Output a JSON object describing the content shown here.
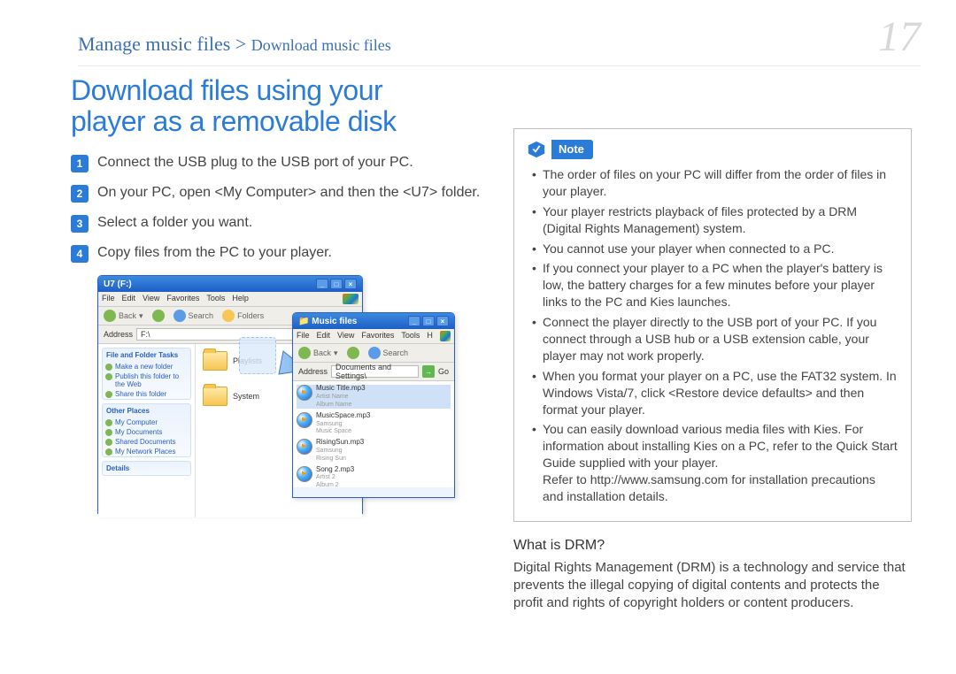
{
  "header": {
    "breadcrumb_main": "Manage music files",
    "breadcrumb_sep": " > ",
    "breadcrumb_sub": "Download music files",
    "page_number": "17"
  },
  "title": {
    "line1": "Download files using your",
    "line2": "player as a removable disk"
  },
  "steps": {
    "s1": "Connect the USB plug to the USB port of your PC.",
    "s2": "On your PC, open <My Computer> and then the <U7> folder.",
    "s3": "Select a folder you want.",
    "s4": "Copy files from the PC to your player."
  },
  "win1": {
    "title": "U7 (F:)",
    "menu": {
      "m1": "File",
      "m2": "Edit",
      "m3": "View",
      "m4": "Favorites",
      "m5": "Tools",
      "m6": "Help"
    },
    "toolbar": {
      "back": "Back",
      "search": "Search",
      "folders": "Folders"
    },
    "addr_label": "Address",
    "addr_value": "F:\\",
    "panel1": {
      "head": "File and Folder Tasks",
      "i1": "Make a new folder",
      "i2": "Publish this folder to the Web",
      "i3": "Share this folder"
    },
    "panel2": {
      "head": "Other Places",
      "i1": "My Computer",
      "i2": "My Documents",
      "i3": "Shared Documents",
      "i4": "My Network Places"
    },
    "panel3": {
      "head": "Details"
    },
    "folders": {
      "f1": "Playlists",
      "f2": "System"
    }
  },
  "win2": {
    "title": "Music files",
    "menu": {
      "m1": "File",
      "m2": "Edit",
      "m3": "View",
      "m4": "Favorites",
      "m5": "Tools",
      "m6": "H"
    },
    "toolbar": {
      "back": "Back",
      "search": "Search"
    },
    "addr_label": "Address",
    "addr_value": "Documents and Settings\\",
    "go": "Go",
    "files": {
      "f1": {
        "name": "Music Title.mp3",
        "l2": "Artist Name",
        "l3": "Album Name"
      },
      "f2": {
        "name": "MusicSpace.mp3",
        "l2": "Samsung",
        "l3": "Music Space"
      },
      "f3": {
        "name": "RisingSun.mp3",
        "l2": "Samsung",
        "l3": "Rising Sun"
      },
      "f4": {
        "name": "Song 2.mp3",
        "l2": "Artist 2",
        "l3": "Album 2"
      }
    }
  },
  "note": {
    "label": "Note",
    "n1": "The order of files on your PC will differ from the order of files in your player.",
    "n2": "Your player restricts playback of files protected by a DRM (Digital Rights Management) system.",
    "n3": "You cannot use your player when connected to a PC.",
    "n4": "If you connect your player to a PC when the player's battery is low, the battery charges for a few minutes before your player links to the PC and Kies launches.",
    "n5": "Connect the player directly to the USB port of your PC. If you connect through a USB hub or a USB extension cable, your player may not work properly.",
    "n6": "When you format your player on a PC, use the FAT32 system. In Windows Vista/7, click <Restore device defaults> and then format your player.",
    "n7a": "You can easily download various media files with Kies. For information about installing Kies on a PC, refer to the Quick Start Guide supplied with your player.",
    "n7b": "Refer to http://www.samsung.com for installation precautions and installation details."
  },
  "drm": {
    "head": "What is DRM?",
    "body": "Digital Rights Management (DRM) is a technology and service that prevents the illegal copying of digital contents and protects the profit and rights of copyright holders or content producers."
  }
}
